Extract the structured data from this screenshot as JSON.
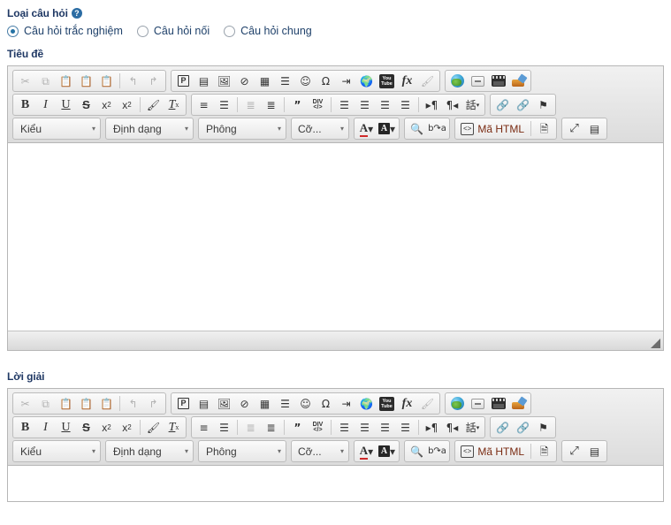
{
  "question_type": {
    "label": "Loại câu hỏi",
    "help_icon": "help-circle-icon",
    "options": [
      {
        "label": "Câu hỏi trắc nghiệm",
        "selected": true
      },
      {
        "label": "Câu hỏi nối",
        "selected": false
      },
      {
        "label": "Câu hỏi chung",
        "selected": false
      }
    ]
  },
  "sections": [
    {
      "label": "Tiêu đề",
      "content": "",
      "has_resize_grip": true
    },
    {
      "label": "Lời giải",
      "content": "",
      "has_resize_grip": false
    }
  ],
  "toolbar": {
    "row1": [
      {
        "group": "clipboard",
        "buttons": [
          {
            "name": "cut-icon",
            "glyph": "✂",
            "disabled": true
          },
          {
            "name": "copy-icon",
            "glyph": "⧉",
            "disabled": true
          },
          {
            "name": "paste-icon",
            "glyph": "📋",
            "disabled": false
          },
          {
            "name": "paste-as-text-icon",
            "glyph": "T",
            "disabled": false
          },
          {
            "name": "paste-from-word-icon",
            "glyph": "W",
            "disabled": false
          },
          {
            "name": "separator",
            "glyph": "",
            "disabled": false
          },
          {
            "name": "undo-icon",
            "glyph": "↰",
            "disabled": true
          },
          {
            "name": "redo-icon",
            "glyph": "↱",
            "disabled": true
          }
        ]
      },
      {
        "group": "insert",
        "buttons": [
          {
            "name": "placeholder-icon",
            "glyph": "P",
            "disabled": false
          },
          {
            "name": "templates-icon",
            "glyph": "▤",
            "disabled": false
          },
          {
            "name": "image-icon",
            "glyph": "🖼",
            "disabled": false
          },
          {
            "name": "flash-icon",
            "glyph": "⊘",
            "disabled": false
          },
          {
            "name": "table-icon",
            "glyph": "▦",
            "disabled": false
          },
          {
            "name": "horizontal-rule-icon",
            "glyph": "≡",
            "disabled": false
          },
          {
            "name": "smiley-icon",
            "glyph": "☺",
            "disabled": false
          },
          {
            "name": "special-char-icon",
            "glyph": "Ω",
            "disabled": false
          },
          {
            "name": "page-break-icon",
            "glyph": "▸≡",
            "disabled": false
          },
          {
            "name": "iframe-icon",
            "glyph": "🌐",
            "disabled": false
          },
          {
            "name": "youtube-icon",
            "glyph": "YouTube",
            "disabled": false
          },
          {
            "name": "mathjax-icon",
            "glyph": "fx",
            "disabled": false
          },
          {
            "name": "magic-line-icon",
            "glyph": "🖌",
            "disabled": true
          }
        ]
      },
      {
        "group": "media",
        "buttons": [
          {
            "name": "globe-icon",
            "glyph": "",
            "disabled": false
          },
          {
            "name": "page-break-button-icon",
            "glyph": "",
            "disabled": false
          },
          {
            "name": "film-icon",
            "glyph": "",
            "disabled": false
          },
          {
            "name": "template-paint-icon",
            "glyph": "",
            "disabled": false
          }
        ]
      }
    ],
    "row2": [
      {
        "group": "basic-styles",
        "buttons": [
          {
            "name": "bold-icon",
            "glyph": "B",
            "disabled": false
          },
          {
            "name": "italic-icon",
            "glyph": "I",
            "disabled": false
          },
          {
            "name": "underline-icon",
            "glyph": "U",
            "disabled": false
          },
          {
            "name": "strikethrough-icon",
            "glyph": "S",
            "disabled": false
          },
          {
            "name": "subscript-icon",
            "glyph": "x₂",
            "disabled": false
          },
          {
            "name": "superscript-icon",
            "glyph": "x²",
            "disabled": false
          },
          {
            "name": "separator",
            "glyph": "",
            "disabled": false
          },
          {
            "name": "remove-format-icon",
            "glyph": "🖌",
            "disabled": false
          },
          {
            "name": "clear-format-icon",
            "glyph": "Tx",
            "disabled": false
          }
        ]
      },
      {
        "group": "paragraph",
        "buttons": [
          {
            "name": "numbered-list-icon",
            "glyph": "1≡",
            "disabled": false
          },
          {
            "name": "bulleted-list-icon",
            "glyph": "•≡",
            "disabled": false
          },
          {
            "name": "separator",
            "glyph": "",
            "disabled": false
          },
          {
            "name": "outdent-icon",
            "glyph": "◃≡",
            "disabled": true
          },
          {
            "name": "indent-icon",
            "glyph": "▹≡",
            "disabled": false
          },
          {
            "name": "separator",
            "glyph": "",
            "disabled": false
          },
          {
            "name": "blockquote-icon",
            "glyph": "❞",
            "disabled": false
          },
          {
            "name": "create-div-icon",
            "glyph": "DIV",
            "disabled": false
          },
          {
            "name": "separator",
            "glyph": "",
            "disabled": false
          },
          {
            "name": "align-left-icon",
            "glyph": "≡",
            "disabled": false
          },
          {
            "name": "align-center-icon",
            "glyph": "≡",
            "disabled": false
          },
          {
            "name": "align-right-icon",
            "glyph": "≡",
            "disabled": false
          },
          {
            "name": "justify-icon",
            "glyph": "≡",
            "disabled": false
          },
          {
            "name": "separator",
            "glyph": "",
            "disabled": false
          },
          {
            "name": "ltr-icon",
            "glyph": "¶",
            "disabled": false
          },
          {
            "name": "rtl-icon",
            "glyph": "¶",
            "disabled": false
          },
          {
            "name": "language-icon",
            "glyph": "話",
            "disabled": false
          }
        ]
      },
      {
        "group": "links",
        "buttons": [
          {
            "name": "link-icon",
            "glyph": "🔗",
            "disabled": false
          },
          {
            "name": "unlink-icon",
            "glyph": "🔗",
            "disabled": true
          },
          {
            "name": "anchor-icon",
            "glyph": "⚑",
            "disabled": false
          }
        ]
      }
    ],
    "row3": {
      "combos": [
        {
          "name": "styles-combo",
          "value": "Kiểu",
          "width": "w-kieu"
        },
        {
          "name": "format-combo",
          "value": "Định dạng",
          "width": "w-dinhdang"
        },
        {
          "name": "font-combo",
          "value": "Phông",
          "width": "w-phong"
        },
        {
          "name": "fontsize-combo",
          "value": "Cỡ...",
          "width": "w-co"
        }
      ],
      "colors_group": [
        {
          "name": "text-color-icon",
          "glyph": "A"
        },
        {
          "name": "background-color-icon",
          "glyph": "A"
        }
      ],
      "find_group": [
        {
          "name": "find-icon",
          "glyph": "🔍"
        },
        {
          "name": "replace-icon",
          "glyph": "ba"
        }
      ],
      "source_group": {
        "source_label": "Mã HTML",
        "source_icon": "source-code-icon",
        "doc_icon": "document-properties-icon"
      },
      "maximize_group": [
        {
          "name": "maximize-icon",
          "glyph": "⤢"
        },
        {
          "name": "show-blocks-icon",
          "glyph": "▤"
        }
      ]
    }
  },
  "colors": {
    "label_text": "#1f3864",
    "radio_accent": "#2472a4",
    "source_label": "#7a2b12",
    "toolbar_bg": "#e4e4e4",
    "editor_border": "#b6b6b6"
  }
}
